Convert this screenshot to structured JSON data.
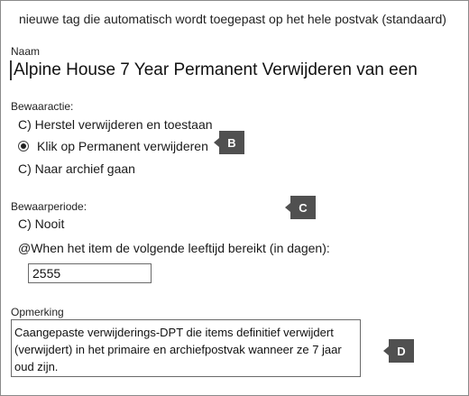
{
  "header": {
    "note": "nieuwe tag die automatisch wordt toegepast op het hele postvak (standaard)"
  },
  "name_section": {
    "label": "Naam",
    "value": "Alpine House 7 Year Permanent Verwijderen van een"
  },
  "retention_action": {
    "label": "Bewaaractie:",
    "options": [
      {
        "label": "C) Herstel verwijderen en toestaan",
        "selected": false
      },
      {
        "label": "Klik op  Permanent verwijderen",
        "selected": true
      },
      {
        "label": "C) Naar archief gaan",
        "selected": false
      }
    ]
  },
  "retention_period": {
    "label": "Bewaarperiode:",
    "never_label": "C) Nooit",
    "age_label": "@When het item de volgende leeftijd bereikt (in dagen):",
    "days_value": "2555"
  },
  "comment": {
    "label": "Opmerking",
    "text": "Caangepaste verwijderings-DPT die items definitief verwijdert (verwijdert) in het primaire en archiefpostvak wanneer ze 7 jaar oud zijn."
  },
  "callouts": {
    "b": "B",
    "c": "C",
    "d": "D"
  }
}
